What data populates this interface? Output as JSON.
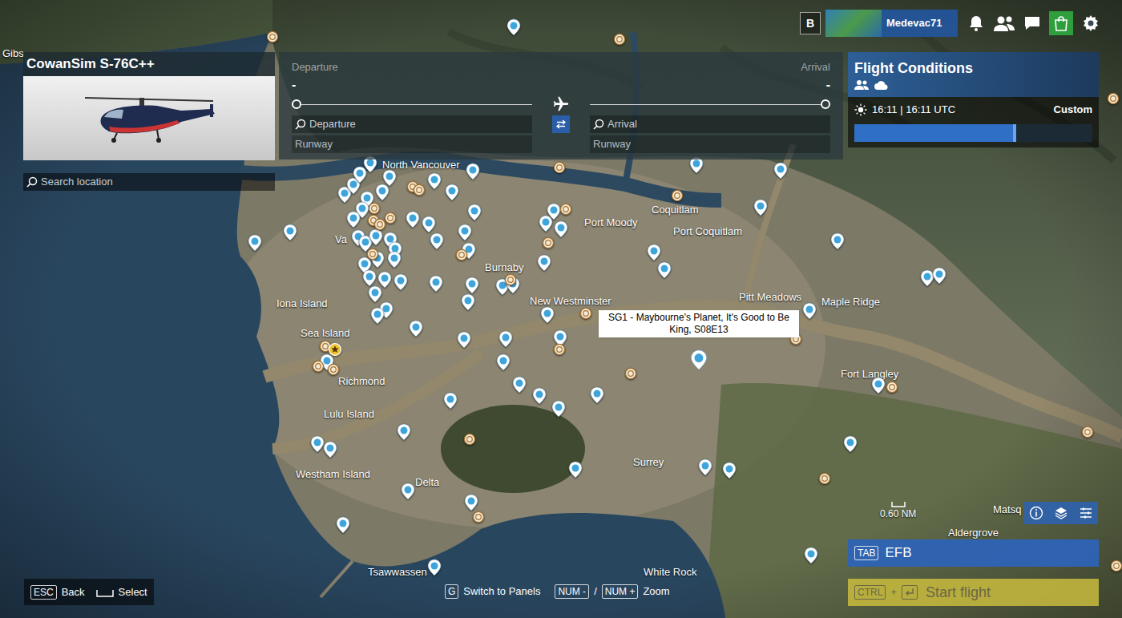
{
  "topbar": {
    "key": "B",
    "username": "Medevac71"
  },
  "aircraft": {
    "name": "CowanSim S-76C++"
  },
  "search": {
    "placeholder": "Search location"
  },
  "route": {
    "departure": {
      "label": "Departure",
      "value": "-",
      "placeholder": "Departure",
      "runway": "Runway"
    },
    "arrival": {
      "label": "Arrival",
      "value": "-",
      "placeholder": "Arrival",
      "runway": "Runway"
    }
  },
  "conditions": {
    "title": "Flight Conditions",
    "time": "16:11 | 16:11 UTC",
    "preset": "Custom",
    "level": 0.68
  },
  "map": {
    "labels": [
      "Gibs",
      "North Vancouver",
      "Va",
      "Port Moody",
      "Coquitlam",
      "Port Coquitlam",
      "Burnaby",
      "New Westminster",
      "Pitt Meadows",
      "Maple Ridge",
      "Iona Island",
      "Sea Island",
      "Richmond",
      "Lulu Island",
      "Fort Langley",
      "Surrey",
      "Westham Island",
      "Delta",
      "Tsawwassen",
      "White Rock",
      "Matsq",
      "Aldergrove"
    ],
    "pins": [
      {
        "kind": "poi"
      },
      {
        "kind": "poi"
      },
      {
        "kind": "poi"
      },
      {
        "kind": "poi"
      },
      {
        "kind": "poi"
      },
      {
        "kind": "poi"
      },
      {
        "kind": "poi"
      },
      {
        "kind": "poi"
      },
      {
        "kind": "poi"
      },
      {
        "kind": "poi"
      },
      {
        "kind": "poi"
      },
      {
        "kind": "poi"
      },
      {
        "kind": "poi"
      },
      {
        "kind": "poi"
      },
      {
        "kind": "poi"
      },
      {
        "kind": "poi"
      },
      {
        "kind": "poi"
      },
      {
        "kind": "poi"
      },
      {
        "kind": "poi"
      },
      {
        "kind": "poi"
      },
      {
        "kind": "poi"
      },
      {
        "kind": "poi"
      },
      {
        "kind": "poi"
      },
      {
        "kind": "poi"
      },
      {
        "kind": "poi"
      },
      {
        "kind": "poi"
      },
      {
        "kind": "poi"
      },
      {
        "kind": "poi"
      },
      {
        "kind": "poi"
      },
      {
        "kind": "poi"
      },
      {
        "kind": "poi"
      },
      {
        "kind": "poi"
      },
      {
        "kind": "poi"
      },
      {
        "kind": "poi"
      },
      {
        "kind": "poi"
      },
      {
        "kind": "poi"
      },
      {
        "kind": "poi"
      },
      {
        "kind": "poi"
      },
      {
        "kind": "poi"
      },
      {
        "kind": "poi"
      },
      {
        "kind": "poi"
      },
      {
        "kind": "poi"
      },
      {
        "kind": "poi"
      },
      {
        "kind": "poi"
      },
      {
        "kind": "poi"
      },
      {
        "kind": "poi"
      },
      {
        "kind": "poi"
      },
      {
        "kind": "poi"
      },
      {
        "kind": "poi"
      },
      {
        "kind": "poi"
      },
      {
        "kind": "poi"
      },
      {
        "kind": "poi"
      },
      {
        "kind": "poi"
      },
      {
        "kind": "poi"
      },
      {
        "kind": "poi"
      },
      {
        "kind": "poi"
      },
      {
        "kind": "poi"
      },
      {
        "kind": "poi"
      },
      {
        "kind": "poi"
      },
      {
        "kind": "poi"
      },
      {
        "kind": "poi"
      },
      {
        "kind": "poi"
      },
      {
        "kind": "poi"
      },
      {
        "kind": "poi"
      },
      {
        "kind": "poi"
      },
      {
        "kind": "poi"
      },
      {
        "kind": "poi"
      },
      {
        "kind": "poi"
      },
      {
        "kind": "poi"
      },
      {
        "kind": "poi"
      },
      {
        "kind": "poi"
      },
      {
        "kind": "poi"
      },
      {
        "kind": "poi"
      },
      {
        "kind": "poi"
      },
      {
        "kind": "poi"
      },
      {
        "kind": "poi"
      },
      {
        "kind": "poi"
      },
      {
        "kind": "poi"
      },
      {
        "kind": "heli"
      },
      {
        "kind": "heli"
      },
      {
        "kind": "heli"
      },
      {
        "kind": "heli"
      },
      {
        "kind": "heli"
      },
      {
        "kind": "heli"
      },
      {
        "kind": "heli"
      },
      {
        "kind": "heli"
      },
      {
        "kind": "heli"
      },
      {
        "kind": "heli"
      },
      {
        "kind": "heli"
      },
      {
        "kind": "heli"
      },
      {
        "kind": "heli"
      },
      {
        "kind": "heli"
      },
      {
        "kind": "heli"
      },
      {
        "kind": "heli"
      },
      {
        "kind": "heli"
      },
      {
        "kind": "heli"
      },
      {
        "kind": "heli"
      },
      {
        "kind": "heli"
      },
      {
        "kind": "heli"
      },
      {
        "kind": "heli"
      },
      {
        "kind": "heli"
      },
      {
        "kind": "heli"
      },
      {
        "kind": "heli"
      },
      {
        "kind": "heli"
      },
      {
        "kind": "heli"
      },
      {
        "kind": "heli"
      },
      {
        "kind": "heli"
      },
      {
        "kind": "airport"
      }
    ],
    "tooltip": {
      "text": "SG1 - Maybourne's Planet, It's Good to Be King, S08E13"
    },
    "scale": "0.60 NM"
  },
  "efb": {
    "key": "TAB",
    "label": "EFB"
  },
  "start": {
    "keys": [
      "CTRL"
    ],
    "plus": "+",
    "label": "Start flight",
    "disabled": true
  },
  "hints": {
    "left": [
      {
        "kind": "text",
        "key": "ESC",
        "label": "Back"
      },
      {
        "kind": "icon",
        "label": "Select"
      }
    ],
    "center": [
      {
        "kind": "text",
        "key": "G",
        "label": "Switch to Panels"
      },
      {
        "kind": "pair",
        "keys": [
          "NUM -",
          "NUM +"
        ],
        "separator": "/",
        "label": "Zoom"
      }
    ]
  }
}
